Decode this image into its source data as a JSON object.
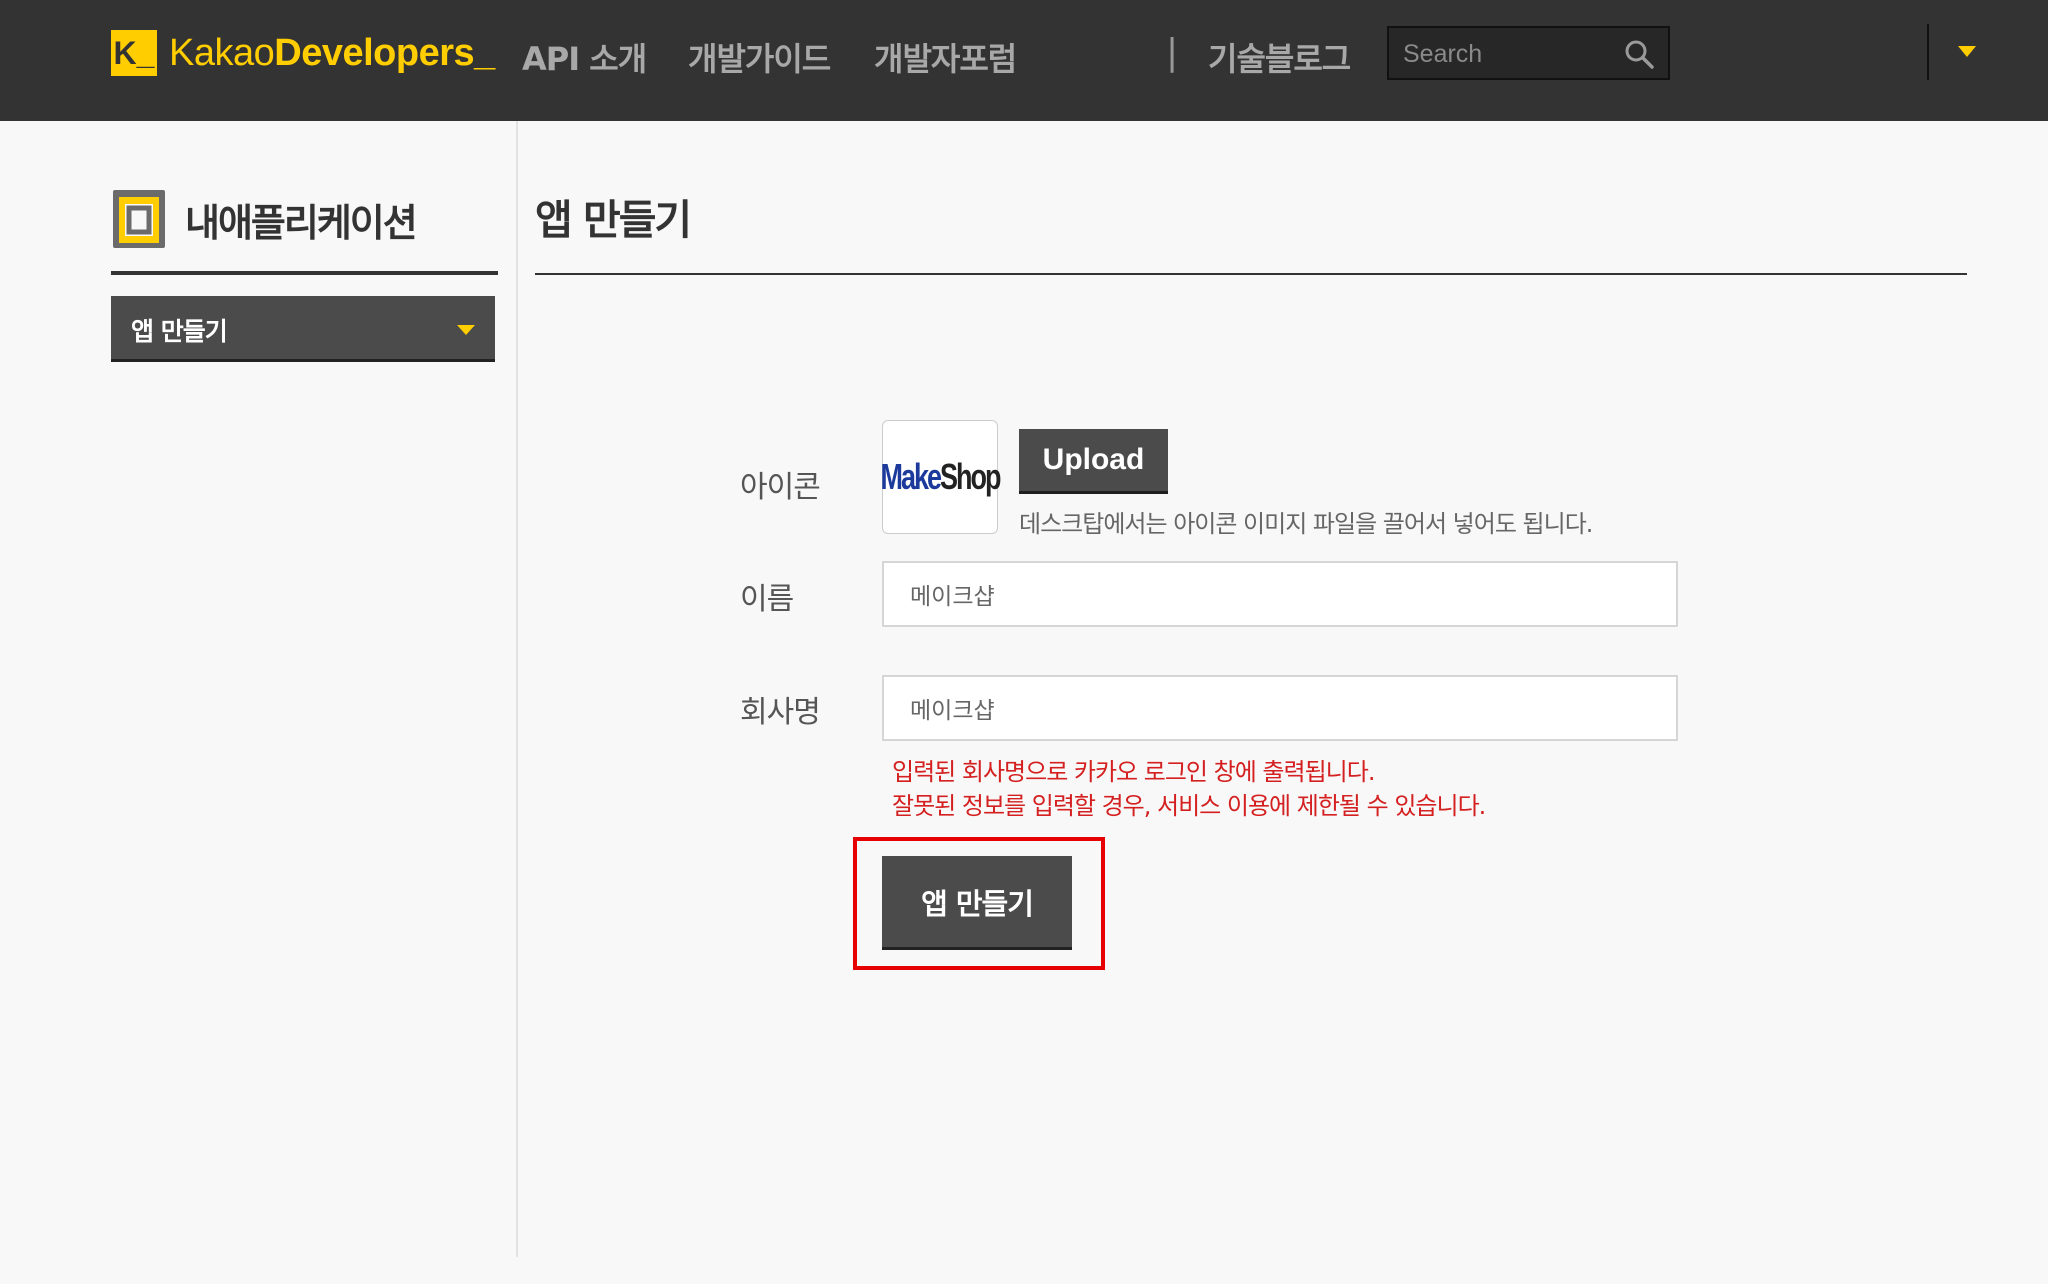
{
  "header": {
    "logo_k": "K_",
    "logo_part1": "Kakao",
    "logo_part2": "Developers",
    "logo_cursor": "_",
    "nav": [
      "API 소개",
      "개발가이드",
      "개발자포럼"
    ],
    "separator": "|",
    "tech_blog": "기술블로그",
    "search_placeholder": "Search"
  },
  "sidebar": {
    "title": "내애플리케이션",
    "menu_selected": "앱 만들기"
  },
  "main": {
    "title": "앱 만들기",
    "form": {
      "icon_label": "아이콘",
      "icon_logo_part1": "Make",
      "icon_logo_part2": "Shop",
      "upload_label": "Upload",
      "upload_hint": "데스크탑에서는 아이콘 이미지 파일을 끌어서 넣어도 됩니다.",
      "name_label": "이름",
      "name_value": "메이크샵",
      "company_label": "회사명",
      "company_value": "메이크샵",
      "warning_line1": "입력된 회사명으로 카카오 로그인 창에 출력됩니다.",
      "warning_line2": "잘못된 정보를 입력할 경우, 서비스 이용에 제한될 수 있습니다.",
      "submit_label": "앱 만들기"
    }
  },
  "colors": {
    "header_bg": "#333333",
    "accent": "#ffcd00",
    "button_bg": "#4b4b4b",
    "warning": "#d42020",
    "highlight": "#e60000"
  }
}
